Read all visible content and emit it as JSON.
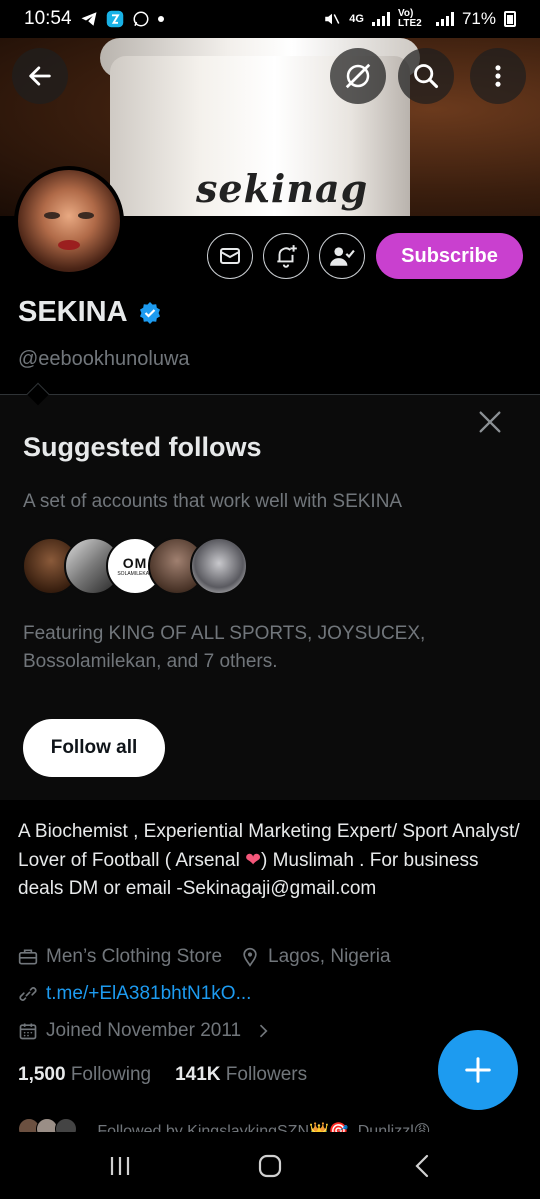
{
  "status_bar": {
    "time": "10:54",
    "network_label": "4G",
    "volte_label": "Vo) LTE2",
    "battery": "71%"
  },
  "banner": {
    "text": "sekinag"
  },
  "profile": {
    "name": "SEKINA",
    "handle": "@eebookhunoluwa",
    "subscribe_label": "Subscribe"
  },
  "suggested": {
    "title": "Suggested follows",
    "subtitle": "A set of accounts that work well with SEKINA",
    "featuring": "Featuring KING OF ALL SPORTS, JOYSUCEX, Bossolamilekan, and 7 others.",
    "follow_all_label": "Follow all",
    "badge_text": "OM",
    "badge_sub": "SOLAMILEKAN"
  },
  "bio": {
    "text_before_heart": "A Biochemist , Experiential Marketing Expert/ Sport Analyst/ Lover of Football ( Arsenal ",
    "heart": "❤",
    "text_after_heart": ") Muslimah . For business deals DM or email -Sekinagaji@gmail.com"
  },
  "meta": {
    "category": "Men’s Clothing Store",
    "location": "Lagos, Nigeria",
    "link": "t.me/+ElA381bhtN1kO...",
    "joined": "Joined November 2011"
  },
  "counts": {
    "following_value": "1,500",
    "following_label": "Following",
    "followers_value": "141K",
    "followers_label": "Followers"
  },
  "followed_by": "Followed by KingslaykingSZN👑🎯, Dunlizzl😩"
}
